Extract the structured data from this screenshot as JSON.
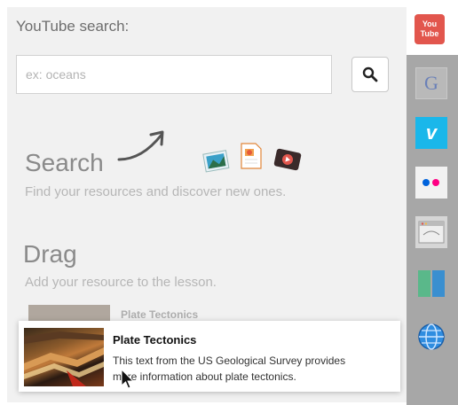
{
  "youtube": {
    "title": "YouTube search:",
    "placeholder": "ex: oceans",
    "tab_line1": "You",
    "tab_line2": "Tube"
  },
  "instructions": {
    "search_heading": "Search",
    "search_desc": "Find your resources and discover new ones.",
    "drag_heading": "Drag",
    "drag_desc": "Add your resource to the lesson."
  },
  "ghost_item": {
    "title": "Plate Tectonics"
  },
  "drag_card": {
    "title": "Plate Tectonics",
    "line1": "This text from the US Geological Survey provides",
    "line2": "more information about plate tectonics."
  },
  "sidebar": {
    "items": [
      {
        "icon": "google-icon",
        "label": "G"
      },
      {
        "icon": "vimeo-icon",
        "label": "v"
      },
      {
        "icon": "flickr-icon"
      },
      {
        "icon": "web-page-icon"
      },
      {
        "icon": "book-icon"
      },
      {
        "icon": "globe-icon"
      }
    ]
  },
  "colors": {
    "youtube_red": "#e2564d",
    "vimeo_blue": "#1ab7ea",
    "flickr_blue": "#0063dc",
    "flickr_pink": "#ff0084",
    "sidebar_bg": "#a7a7a7"
  }
}
